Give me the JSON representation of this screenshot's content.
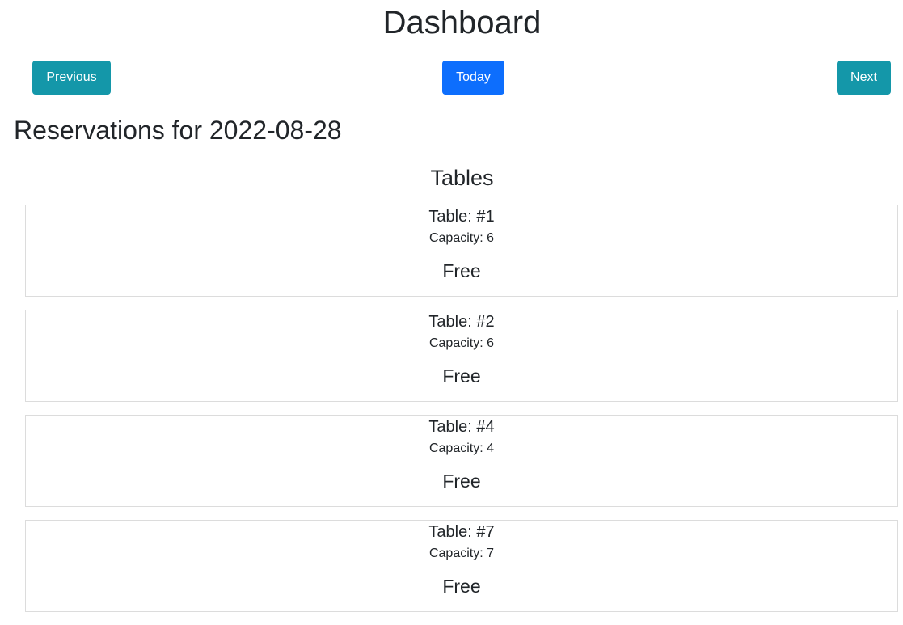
{
  "header": {
    "title": "Dashboard"
  },
  "nav": {
    "previous_label": "Previous",
    "today_label": "Today",
    "next_label": "Next"
  },
  "reservations": {
    "heading": "Reservations for 2022-08-28"
  },
  "tables": {
    "heading": "Tables",
    "items": [
      {
        "name": "Table: #1",
        "capacity": "Capacity: 6",
        "status": "Free"
      },
      {
        "name": "Table: #2",
        "capacity": "Capacity: 6",
        "status": "Free"
      },
      {
        "name": "Table: #4",
        "capacity": "Capacity: 4",
        "status": "Free"
      },
      {
        "name": "Table: #7",
        "capacity": "Capacity: 7",
        "status": "Free"
      }
    ]
  },
  "colors": {
    "info_button": "#1497a9",
    "primary_button": "#0d6efd",
    "text": "#212529",
    "card_border": "#dcdcdc"
  }
}
